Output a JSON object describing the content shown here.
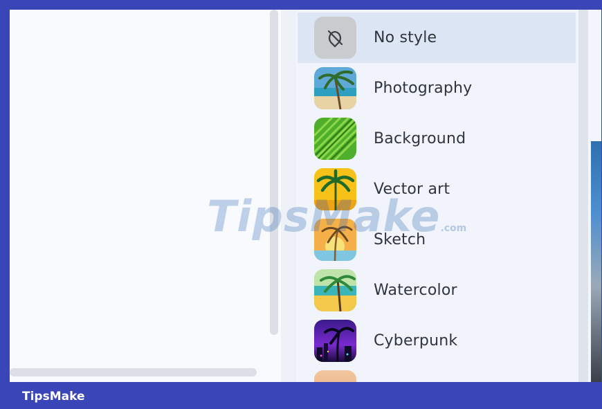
{
  "style_menu": {
    "items": [
      {
        "label": "No style",
        "icon": "no-style-icon",
        "selected": true
      },
      {
        "label": "Photography",
        "icon": "photography-thumbnail"
      },
      {
        "label": "Background",
        "icon": "background-thumbnail"
      },
      {
        "label": "Vector art",
        "icon": "vector-art-thumbnail"
      },
      {
        "label": "Sketch",
        "icon": "sketch-thumbnail"
      },
      {
        "label": "Watercolor",
        "icon": "watercolor-thumbnail"
      },
      {
        "label": "Cyberpunk",
        "icon": "cyberpunk-thumbnail"
      }
    ]
  },
  "watermark": {
    "main": "TipsMake",
    "suffix": ".com"
  },
  "footer": {
    "brand": "TipsMake"
  },
  "colors": {
    "frame": "#3a45b8",
    "selected": "#dde6f5",
    "menu": "#f1f4fa"
  }
}
